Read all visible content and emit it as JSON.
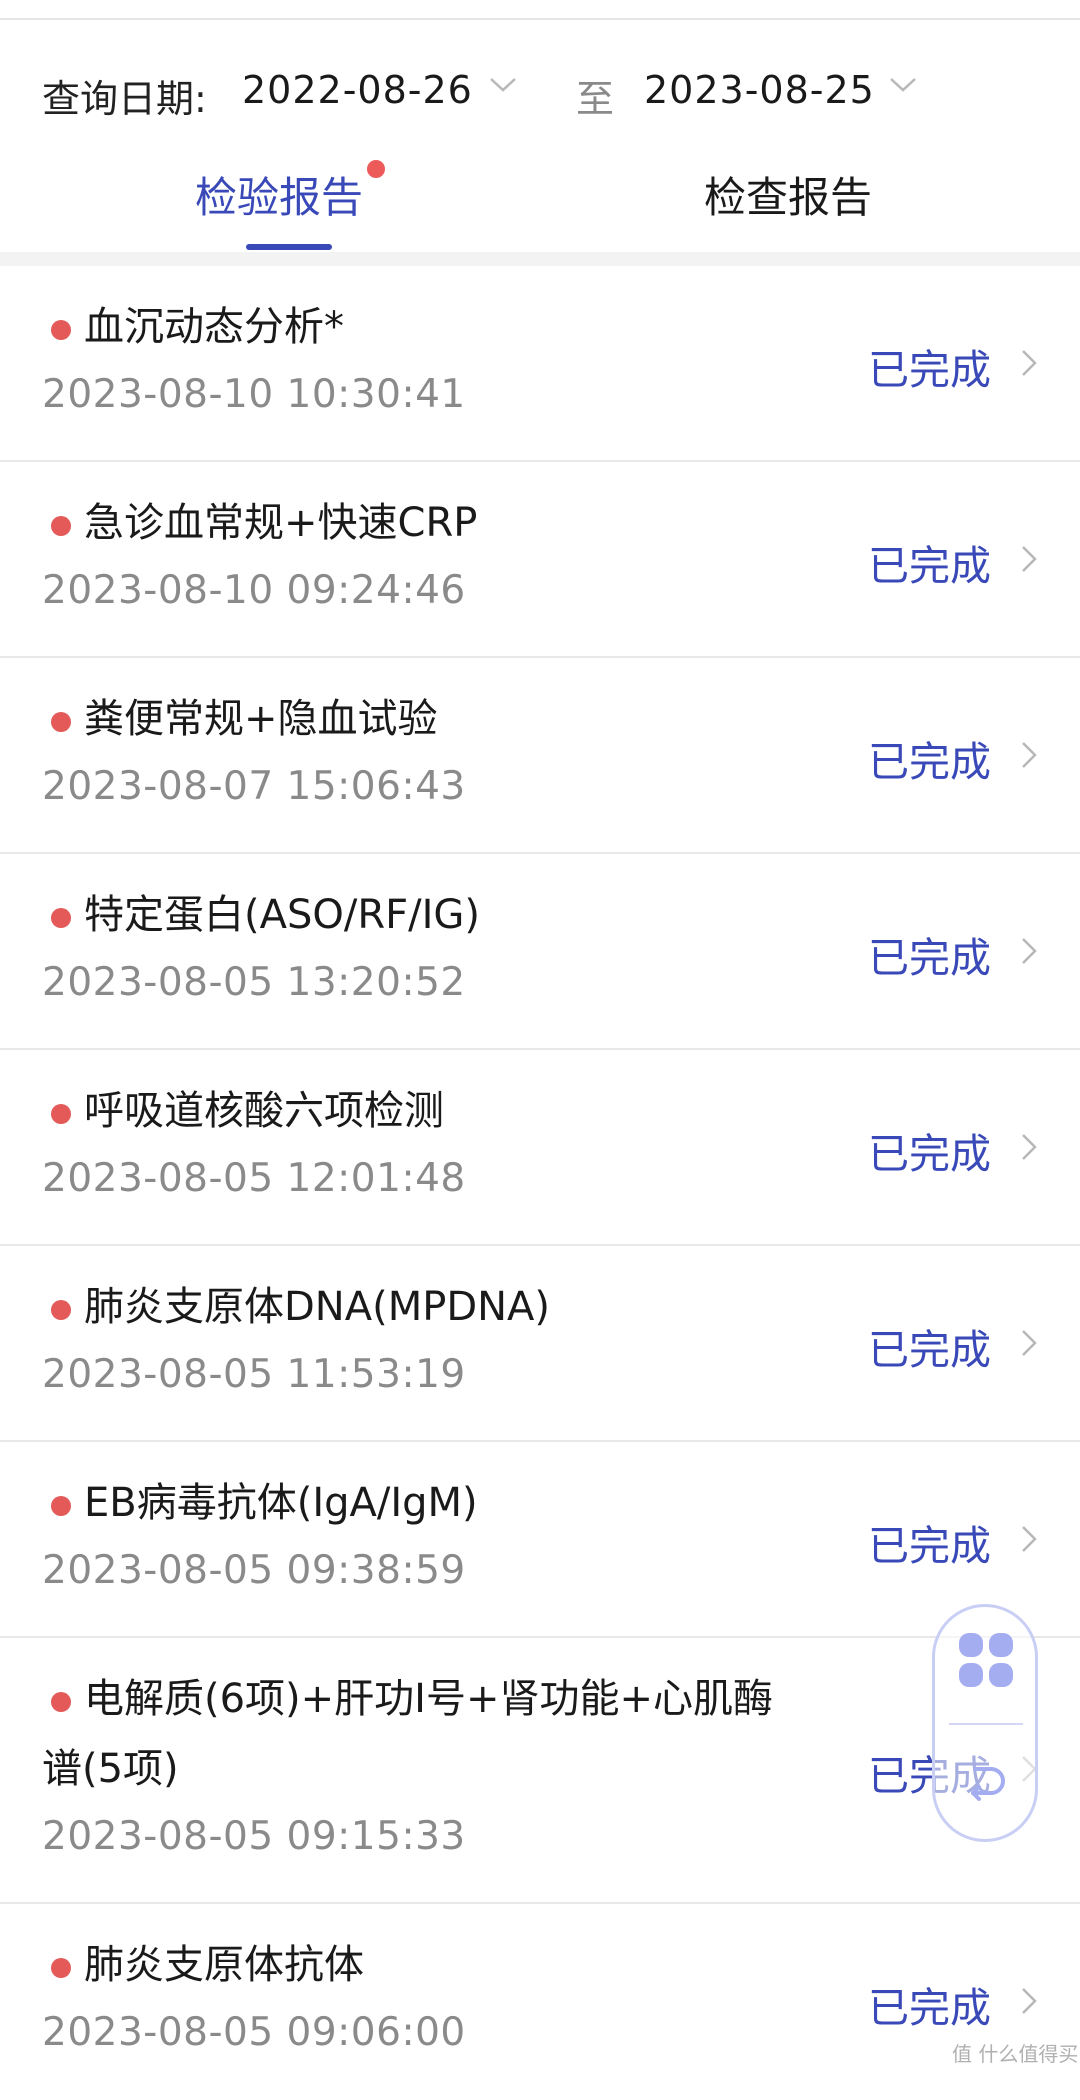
{
  "date_query": {
    "label": "查询日期:",
    "start": "2022-08-26",
    "to": "至",
    "end": "2023-08-25"
  },
  "tabs": [
    {
      "label": "检验报告",
      "active": true,
      "has_badge": true
    },
    {
      "label": "检查报告",
      "active": false,
      "has_badge": false
    }
  ],
  "reports": [
    {
      "title": "血沉动态分析*",
      "time": "2023-08-10 10:30:41",
      "status": "已完成"
    },
    {
      "title": "急诊血常规+快速CRP",
      "time": "2023-08-10 09:24:46",
      "status": "已完成"
    },
    {
      "title": "粪便常规+隐血试验",
      "time": "2023-08-07 15:06:43",
      "status": "已完成"
    },
    {
      "title": "特定蛋白(ASO/RF/IG)",
      "time": "2023-08-05 13:20:52",
      "status": "已完成"
    },
    {
      "title": "呼吸道核酸六项检测",
      "time": "2023-08-05 12:01:48",
      "status": "已完成"
    },
    {
      "title": "肺炎支原体DNA(MPDNA)",
      "time": "2023-08-05 11:53:19",
      "status": "已完成"
    },
    {
      "title": "EB病毒抗体(IgA/IgM)",
      "time": "2023-08-05 09:38:59",
      "status": "已完成"
    },
    {
      "title": "电解质(6项)+肝功I号+肾功能+心肌酶谱(5项)",
      "time": "2023-08-05 09:15:33",
      "status": "已完成"
    },
    {
      "title": "肺炎支原体抗体",
      "time": "2023-08-05 09:06:00",
      "status": "已完成"
    }
  ],
  "colors": {
    "accent": "#3a49b8",
    "dot": "#e35a58",
    "muted": "#8a8a8a"
  },
  "watermark": "值 什么值得买"
}
